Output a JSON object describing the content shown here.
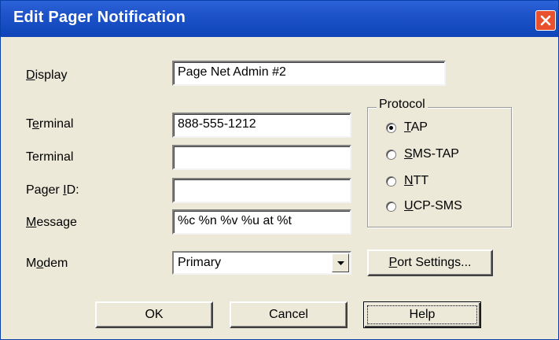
{
  "window": {
    "title": "Edit Pager Notification"
  },
  "fields": {
    "display": {
      "label_pre": "",
      "label_key": "D",
      "label_post": "isplay",
      "value": "Page Net Admin #2"
    },
    "terminal1": {
      "label_pre": "T",
      "label_key": "e",
      "label_post": "rminal",
      "value": "888-555-1212"
    },
    "terminal2": {
      "label": "Terminal",
      "value": ""
    },
    "pager_id": {
      "label_pre": "Pager ",
      "label_key": "I",
      "label_post": "D:",
      "value": ""
    },
    "message": {
      "label_pre": "",
      "label_key": "M",
      "label_post": "essage",
      "value": "%c %n %v %u at %t"
    },
    "modem": {
      "label_pre": "M",
      "label_key": "o",
      "label_post": "dem",
      "selected": "Primary"
    }
  },
  "protocol": {
    "title": "Protocol",
    "options": [
      {
        "pre": "",
        "key": "T",
        "post": "AP",
        "selected": true
      },
      {
        "pre": "",
        "key": "S",
        "post": "MS-TAP",
        "selected": false
      },
      {
        "pre": "",
        "key": "N",
        "post": "TT",
        "selected": false
      },
      {
        "pre": "",
        "key": "U",
        "post": "CP-SMS",
        "selected": false
      }
    ]
  },
  "buttons": {
    "port_settings": {
      "pre": "",
      "key": "P",
      "post": "ort Settings..."
    },
    "ok": "OK",
    "cancel": "Cancel",
    "help": "Help"
  },
  "icons": {
    "close": "close-icon",
    "dropdown": "chevron-down-icon"
  },
  "colors": {
    "titlebar": "#1d52c9",
    "close_button": "#e8502e",
    "dialog_face": "#ece9d8"
  }
}
